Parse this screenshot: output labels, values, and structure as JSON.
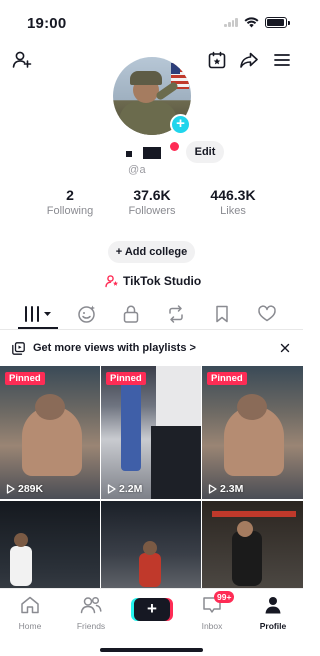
{
  "status_bar": {
    "time": "19:00"
  },
  "profile": {
    "username": "@a",
    "edit_label": "Edit",
    "stats": [
      {
        "value": "2",
        "label": "Following"
      },
      {
        "value": "37.6K",
        "label": "Followers"
      },
      {
        "value": "446.3K",
        "label": "Likes"
      }
    ],
    "add_college_label": "+ Add college",
    "studio_label": "TikTok Studio"
  },
  "playlist_banner": {
    "text": "Get more views with playlists >"
  },
  "videos": [
    {
      "pinned": "Pinned",
      "views": "289K"
    },
    {
      "pinned": "Pinned",
      "views": "2.2M"
    },
    {
      "pinned": "Pinned",
      "views": "2.3M"
    },
    {
      "pinned": "",
      "views": ""
    },
    {
      "pinned": "",
      "views": ""
    },
    {
      "pinned": "",
      "views": ""
    }
  ],
  "bottom_nav": {
    "home": "Home",
    "friends": "Friends",
    "inbox": "Inbox",
    "inbox_badge": "99+",
    "profile": "Profile"
  },
  "colors": {
    "accent": "#fe2c55",
    "cyan": "#20d5ec",
    "text": "#161823"
  }
}
